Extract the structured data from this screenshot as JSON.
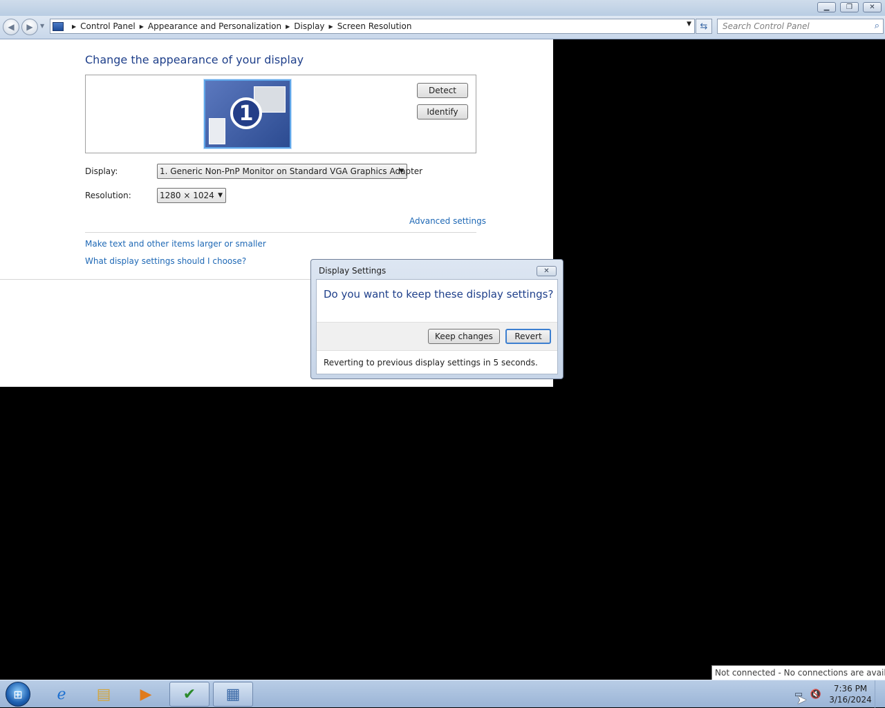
{
  "window": {
    "minimize_icon": "minimize-icon",
    "restore_icon": "restore-icon",
    "close_icon": "close-icon"
  },
  "navbar": {
    "back_icon": "back-arrow-icon",
    "forward_icon": "forward-arrow-icon",
    "breadcrumbs": [
      "Control Panel",
      "Appearance and Personalization",
      "Display",
      "Screen Resolution"
    ],
    "search_placeholder": "Search Control Panel"
  },
  "main": {
    "heading": "Change the appearance of your display",
    "monitor_number": "1",
    "detect_label": "Detect",
    "identify_label": "Identify",
    "display_label": "Display:",
    "display_value": "1. Generic Non-PnP Monitor on Standard VGA Graphics Adapter",
    "resolution_label": "Resolution:",
    "resolution_value": "1280 × 1024",
    "advanced_link": "Advanced settings",
    "text_size_link": "Make text and other items larger or smaller",
    "help_link": "What display settings should I choose?"
  },
  "dialog": {
    "title": "Display Settings",
    "question": "Do you want to keep these display settings?",
    "keep_label": "Keep changes",
    "revert_label": "Revert",
    "status": "Reverting to previous display settings in 5 seconds."
  },
  "taskbar": {
    "tooltip": "Not connected - No connections are available",
    "time": "7:36 PM",
    "date": "3/16/2024",
    "items": [
      "start-orb",
      "internet-explorer-icon",
      "windows-explorer-icon",
      "media-player-icon",
      "action-center-icon",
      "control-panel-icon"
    ]
  },
  "colors": {
    "heading": "#1e3f8a",
    "link": "#1e68b5",
    "desktop": "#000000"
  }
}
